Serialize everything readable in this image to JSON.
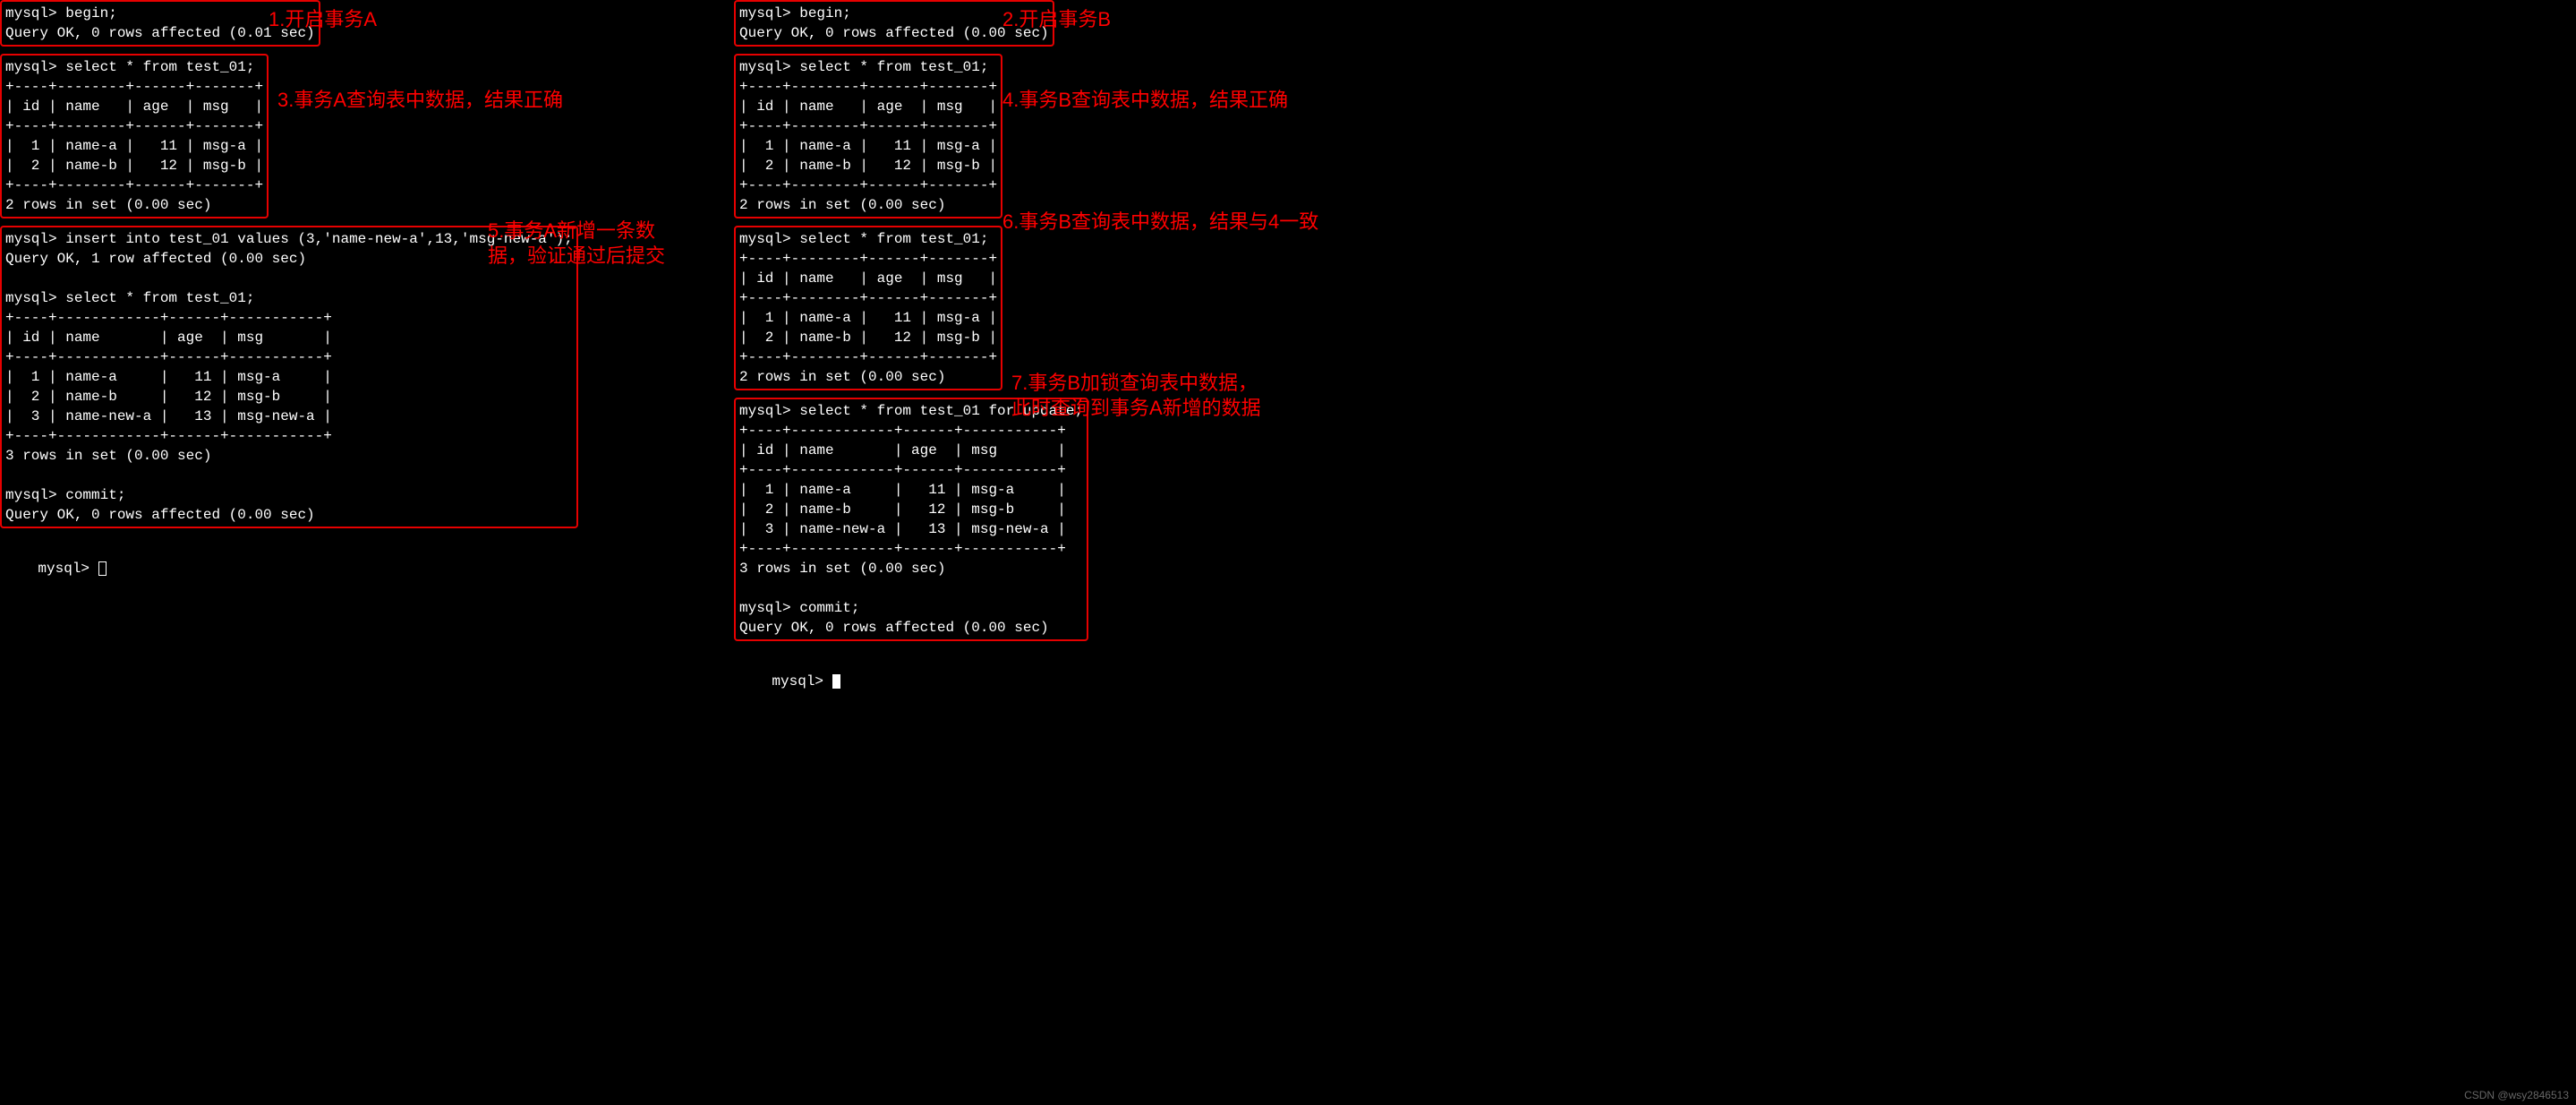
{
  "left": {
    "box1": "mysql> begin;\nQuery OK, 0 rows affected (0.01 sec)",
    "box2": "mysql> select * from test_01;\n+----+--------+------+-------+\n| id | name   | age  | msg   |\n+----+--------+------+-------+\n|  1 | name-a |   11 | msg-a |\n|  2 | name-b |   12 | msg-b |\n+----+--------+------+-------+\n2 rows in set (0.00 sec)",
    "box3": "mysql> insert into test_01 values (3,'name-new-a',13,'msg-new-a');\nQuery OK, 1 row affected (0.00 sec)\n\nmysql> select * from test_01;\n+----+------------+------+-----------+\n| id | name       | age  | msg       |\n+----+------------+------+-----------+\n|  1 | name-a     |   11 | msg-a     |\n|  2 | name-b     |   12 | msg-b     |\n|  3 | name-new-a |   13 | msg-new-a |\n+----+------------+------+-----------+\n3 rows in set (0.00 sec)\n\nmysql> commit;\nQuery OK, 0 rows affected (0.00 sec)",
    "prompt": "mysql> "
  },
  "right": {
    "box1": "mysql> begin;\nQuery OK, 0 rows affected (0.00 sec)",
    "box2": "mysql> select * from test_01;\n+----+--------+------+-------+\n| id | name   | age  | msg   |\n+----+--------+------+-------+\n|  1 | name-a |   11 | msg-a |\n|  2 | name-b |   12 | msg-b |\n+----+--------+------+-------+\n2 rows in set (0.00 sec)",
    "box3": "mysql> select * from test_01;\n+----+--------+------+-------+\n| id | name   | age  | msg   |\n+----+--------+------+-------+\n|  1 | name-a |   11 | msg-a |\n|  2 | name-b |   12 | msg-b |\n+----+--------+------+-------+\n2 rows in set (0.00 sec)",
    "box4": "mysql> select * from test_01 for update;\n+----+------------+------+-----------+\n| id | name       | age  | msg       |\n+----+------------+------+-----------+\n|  1 | name-a     |   11 | msg-a     |\n|  2 | name-b     |   12 | msg-b     |\n|  3 | name-new-a |   13 | msg-new-a |\n+----+------------+------+-----------+\n3 rows in set (0.00 sec)\n\nmysql> commit;\nQuery OK, 0 rows affected (0.00 sec)",
    "prompt": "mysql> "
  },
  "annotations": {
    "a1": "1.开启事务A",
    "a2": "2.开启事务B",
    "a3": "3.事务A查询表中数据，结果正确",
    "a4": "4.事务B查询表中数据，结果正确",
    "a5": "5.事务A新增一条数\n据，验证通过后提交",
    "a6": "6.事务B查询表中数据，结果与4一致",
    "a7": "7.事务B加锁查询表中数据，\n此时查询到事务A新增的数据"
  },
  "watermark": "CSDN @wsy2846513"
}
